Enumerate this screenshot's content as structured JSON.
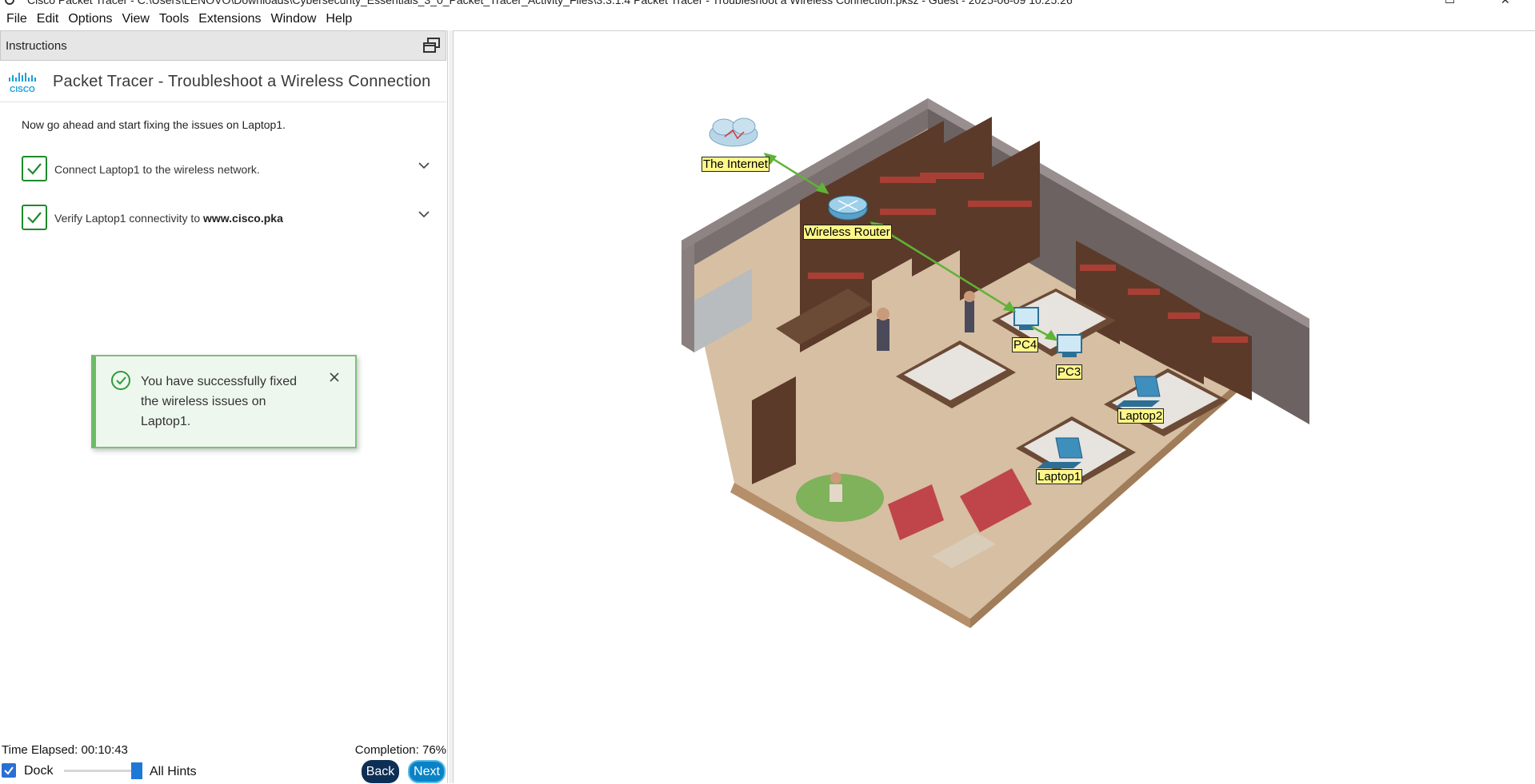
{
  "window": {
    "title": "Cisco Packet Tracer - C:\\Users\\LENOVO\\Downloads\\Cybersecurity_Essentials_3_0_Packet_Tracer_Activity_Files\\3.3.1.4 Packet Tracer - Troubleshoot a Wireless Connection.pksz - Guest - 2025-06-09 10:25:26"
  },
  "menu": [
    "File",
    "Edit",
    "Options",
    "View",
    "Tools",
    "Extensions",
    "Window",
    "Help"
  ],
  "instructions": {
    "header": "Instructions",
    "title": "Packet Tracer - Troubleshoot a Wireless Connection",
    "intro": "Now go ahead and start fixing the issues on Laptop1.",
    "tasks": [
      {
        "text": "Connect Laptop1 to the wireless network.",
        "bold": "",
        "done": true
      },
      {
        "text": "Verify Laptop1 connectivity to ",
        "bold": "www.cisco.pka",
        "done": true
      }
    ],
    "toast": "You have successfully fixed the wireless issues on Laptop1."
  },
  "status": {
    "elapsed": "Time Elapsed: 00:10:43",
    "completion": "Completion: 76%",
    "dock_label": "Dock",
    "dock_checked": true,
    "hints_label": "All Hints",
    "back": "Back",
    "next": "Next"
  },
  "devices": {
    "internet": "The Internet",
    "router": "Wireless Router",
    "pc4": "PC4",
    "pc3": "PC3",
    "laptop2": "Laptop2",
    "laptop1": "Laptop1"
  },
  "colors": {
    "check_green": "#1e8a2b",
    "toast_bg": "#eef7ee",
    "toast_border": "#7dc07a",
    "link_green": "#5fb336",
    "back_btn": "#0d2e55",
    "next_btn": "#0a83c6",
    "label_bg": "#fff78a"
  }
}
